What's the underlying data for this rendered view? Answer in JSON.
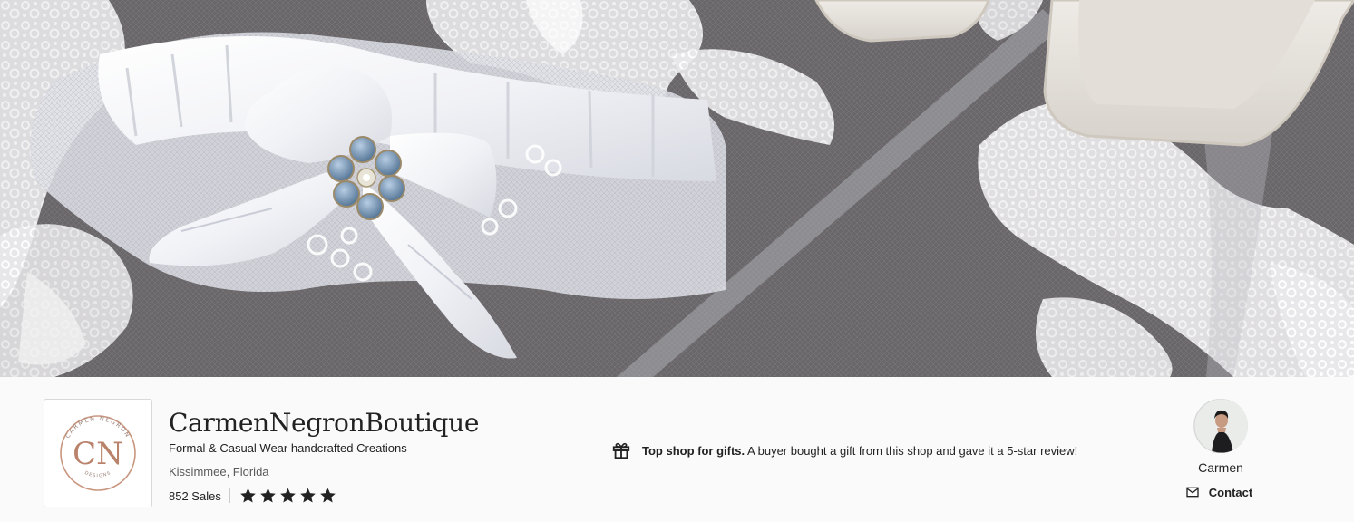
{
  "banner": {
    "image": "wedding-garter-lace-veil-photo"
  },
  "shop": {
    "logo_monogram": "CN",
    "logo_text_top": "CARMEN NEGRON",
    "logo_text_bottom": "DESIGNS",
    "name": "CarmenNegronBoutique",
    "tagline": "Formal & Casual Wear handcrafted Creations",
    "location": "Kissimmee, Florida",
    "sales": "852 Sales",
    "rating": 5
  },
  "gift": {
    "icon": "gift-icon",
    "bold": "Top shop for gifts.",
    "text": "A buyer bought a gift from this shop and gave it a 5-star review!"
  },
  "owner": {
    "name": "Carmen",
    "contact_label": "Contact",
    "contact_icon": "mail-icon"
  },
  "colors": {
    "background": "#fafafa",
    "text": "#222222",
    "logo_rose_gold": "#c9967f"
  }
}
